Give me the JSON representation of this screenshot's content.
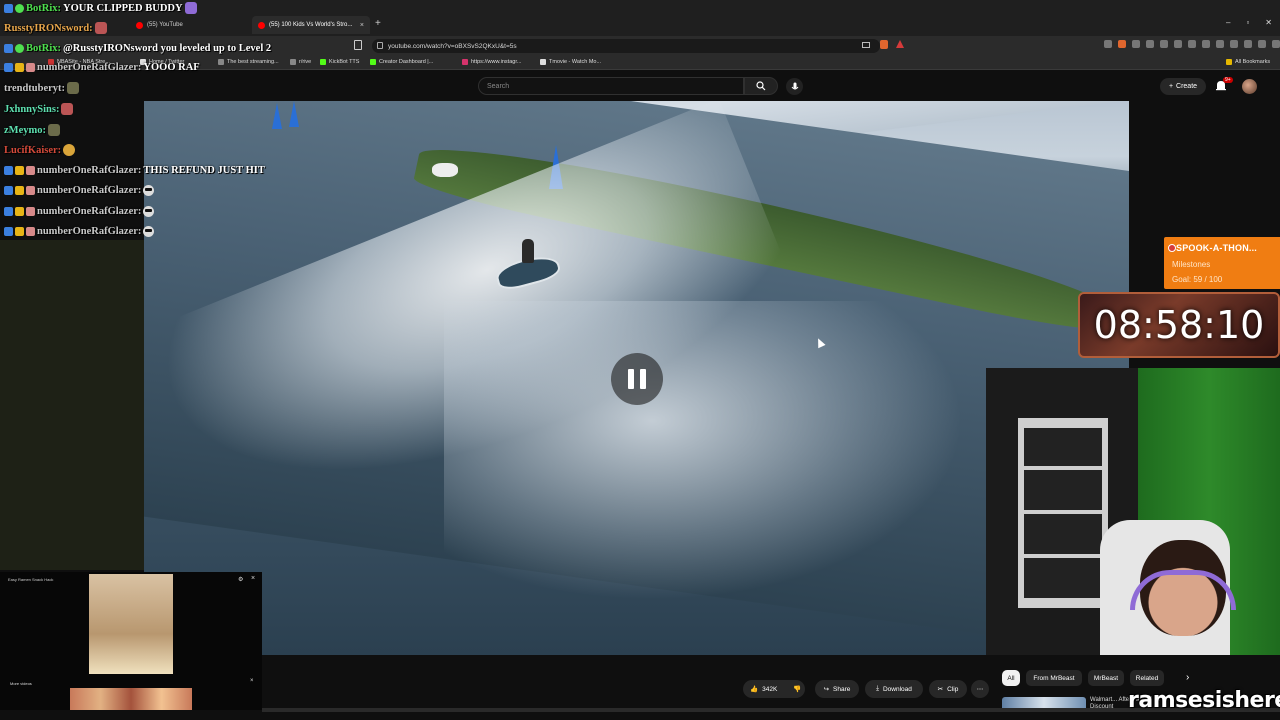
{
  "browser": {
    "tabs": [
      {
        "label": "(55) YouTube"
      },
      {
        "label": "(55) 100 Kids Vs World's Stro..."
      }
    ],
    "url": "youtube.com/watch?v=oBXSvS2QKxU&t=5s",
    "bookmarks": [
      {
        "label": "NBASite - NBA Stre..."
      },
      {
        "label": "Home / Twitter"
      },
      {
        "label": "The best streaming..."
      },
      {
        "label": "r/rive"
      },
      {
        "label": "KickBot TTS"
      },
      {
        "label": "Creator Dashboard |..."
      },
      {
        "label": "https://www.instagr..."
      },
      {
        "label": "Tmovie - Watch Mo..."
      },
      {
        "label": "All Bookmarks"
      }
    ]
  },
  "youtube": {
    "search_placeholder": "Search",
    "create_label": "Create",
    "notification_count": "9+",
    "actions": {
      "likes": "342K",
      "share": "Share",
      "download": "Download",
      "clip": "Clip"
    },
    "chips": [
      "All",
      "From MrBeast",
      "MrBeast",
      "Related"
    ],
    "rec_title": "Walmart... After I asked for a Discount"
  },
  "chat": [
    {
      "user": "BotRix:",
      "msg": "YOUR CLIPPED BUDDY",
      "color": "#4fe04f"
    },
    {
      "user": "RusstyIRONsword:",
      "msg": "",
      "color": "#e8a64b"
    },
    {
      "user": "BotRix:",
      "msg": "@RusstyIRONsword you leveled up to Level 2",
      "color": "#4fe04f"
    },
    {
      "user": "numberOneRafGlazer:",
      "msg": "YOOO RAF",
      "color": "#c8c8c8"
    },
    {
      "user": "trendtuberyt:",
      "msg": "",
      "color": "#c8c8c8"
    },
    {
      "user": "JxhnnySins:",
      "msg": "",
      "color": "#5ee0b0"
    },
    {
      "user": "zMeymo:",
      "msg": "",
      "color": "#5ee0b0"
    },
    {
      "user": "LucifKaiser:",
      "msg": "",
      "color": "#d44a3a"
    },
    {
      "user": "numberOneRafGlazer:",
      "msg": "THIS REFUND JUST HIT",
      "color": "#c8c8c8"
    },
    {
      "user": "numberOneRafGlazer:",
      "msg": "",
      "color": "#c8c8c8"
    },
    {
      "user": "numberOneRafGlazer:",
      "msg": "",
      "color": "#c8c8c8"
    },
    {
      "user": "numberOneRafGlazer:",
      "msg": "",
      "color": "#c8c8c8"
    }
  ],
  "mini": {
    "title": "Easy Ramen Snack Hack",
    "more": "More videos"
  },
  "subathon": {
    "title": "SPOOK-A-THON...",
    "line2": "Milestones",
    "goal": "Goal: 59 / 100",
    "timer": "08:58:10"
  },
  "watermark": "ramsesishere",
  "colors": {
    "accent": "#ff0000",
    "subathon": "#f07d12"
  }
}
